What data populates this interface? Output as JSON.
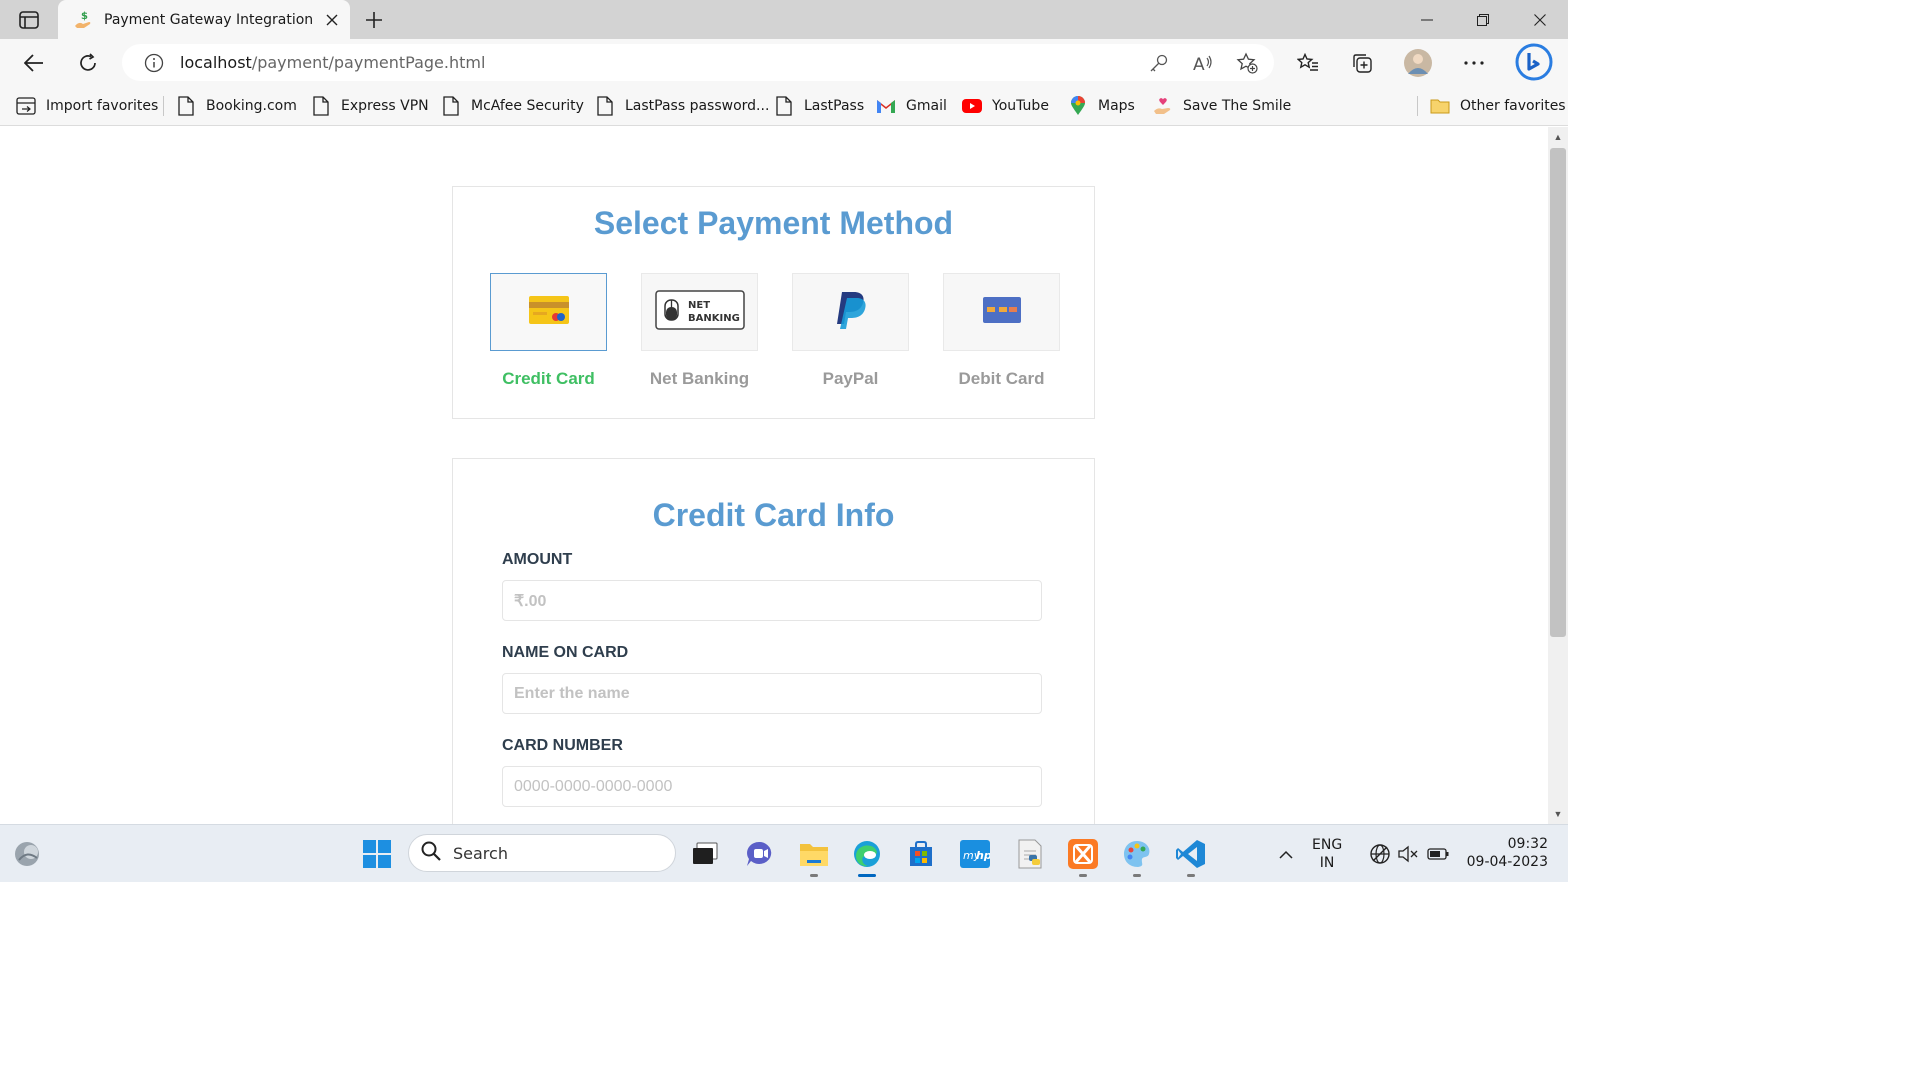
{
  "browser": {
    "tab_title": "Payment Gateway Integration",
    "url_host": "localhost",
    "url_path": "/payment/paymentPage.html"
  },
  "favorites": [
    {
      "label": "Import favorites",
      "icon": "import-icon"
    },
    {
      "label": "Booking.com",
      "icon": "page-icon"
    },
    {
      "label": "Express VPN",
      "icon": "page-icon"
    },
    {
      "label": "McAfee Security",
      "icon": "page-icon"
    },
    {
      "label": "LastPass password...",
      "icon": "page-icon"
    },
    {
      "label": "LastPass",
      "icon": "page-icon"
    },
    {
      "label": "Gmail",
      "icon": "gmail-icon"
    },
    {
      "label": "YouTube",
      "icon": "youtube-icon"
    },
    {
      "label": "Maps",
      "icon": "maps-icon"
    },
    {
      "label": "Save The Smile",
      "icon": "heart-hand-icon"
    }
  ],
  "other_favorites": "Other favorites",
  "payment": {
    "title": "Select Payment Method",
    "methods": [
      {
        "label": "Credit Card",
        "icon": "credit-card-icon",
        "selected": true
      },
      {
        "label": "Net Banking",
        "icon": "net-banking-icon",
        "selected": false
      },
      {
        "label": "PayPal",
        "icon": "paypal-icon",
        "selected": false
      },
      {
        "label": "Debit Card",
        "icon": "debit-card-icon",
        "selected": false
      }
    ]
  },
  "card_info": {
    "title": "Credit Card Info",
    "fields": [
      {
        "label": "AMOUNT",
        "placeholder": "₹.00"
      },
      {
        "label": "NAME ON CARD",
        "placeholder": "Enter the name"
      },
      {
        "label": "CARD NUMBER",
        "placeholder": "0000-0000-0000-0000"
      }
    ]
  },
  "taskbar": {
    "search_label": "Search",
    "lang_line1": "ENG",
    "lang_line2": "IN",
    "time": "09:32",
    "date": "09-04-2023"
  },
  "colors": {
    "title_blue": "#5a9bd1",
    "selected_green": "#3fbf63",
    "label_dark": "#2f3e4d"
  }
}
